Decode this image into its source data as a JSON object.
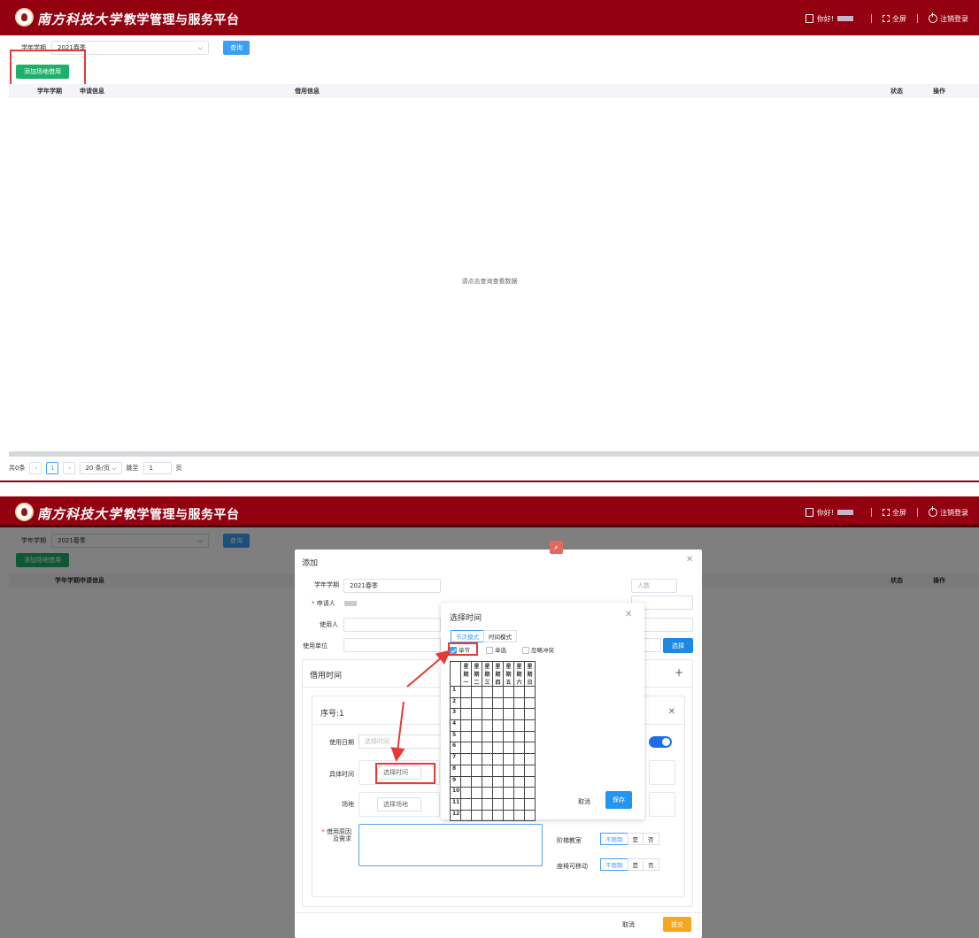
{
  "header": {
    "university": "南方科技大学",
    "platform": "教学管理与服务平台",
    "greeting": "你好!",
    "fullscreen": "全屏",
    "logout": "注销登录"
  },
  "filter": {
    "label": "学年学期",
    "value": "2021春季",
    "query_button": "查询"
  },
  "toolbar": {
    "add_button": "添加场地借用"
  },
  "table": {
    "columns": [
      "学年学期",
      "申请信息",
      "借用信息",
      "状态",
      "操作"
    ],
    "empty_text": "请点击查询查看数据"
  },
  "pager": {
    "total": "共0条",
    "current_page": "1",
    "page_size": "20 条/页",
    "jump_label": "跳至",
    "jump_value": "1",
    "page_unit": "页"
  },
  "dialog": {
    "title": "添加",
    "term_label": "学年学期",
    "term_value": "2021春季",
    "applicant_label": "申请人",
    "user_label": "使用人",
    "unit_label": "使用单位",
    "select_button": "选择",
    "count_placeholder": "人数",
    "borrow_time_title": "借用时间",
    "item_title": "序号:1",
    "use_date_label": "使用日期",
    "use_date_placeholder": "选择时间",
    "specific_time_label": "具体时间",
    "choose_time_button": "选择时间",
    "venue_label": "场地",
    "choose_venue_button": "选择场地",
    "reason_label_1": "借用原因",
    "reason_label_2": "及需求",
    "tiered_label": "阶梯教室",
    "seat_label": "座椅可移动",
    "opt_unlimited": "不限制",
    "opt_yes": "是",
    "opt_no": "否",
    "cancel": "取消",
    "submit": "提交"
  },
  "time_popup": {
    "title": "选择时间",
    "tab_section": "节次模式",
    "tab_time": "时间模式",
    "opt_single": "单节",
    "opt_single_select": "单选",
    "opt_ignore": "忽略冲突",
    "weekdays": [
      "星期一",
      "星期二",
      "星期三",
      "星期四",
      "星期五",
      "星期六",
      "星期日"
    ],
    "periods": [
      "1",
      "2",
      "3",
      "4",
      "5",
      "6",
      "7",
      "8",
      "9",
      "10",
      "11",
      "12"
    ],
    "cancel": "取消",
    "save": "保存"
  }
}
